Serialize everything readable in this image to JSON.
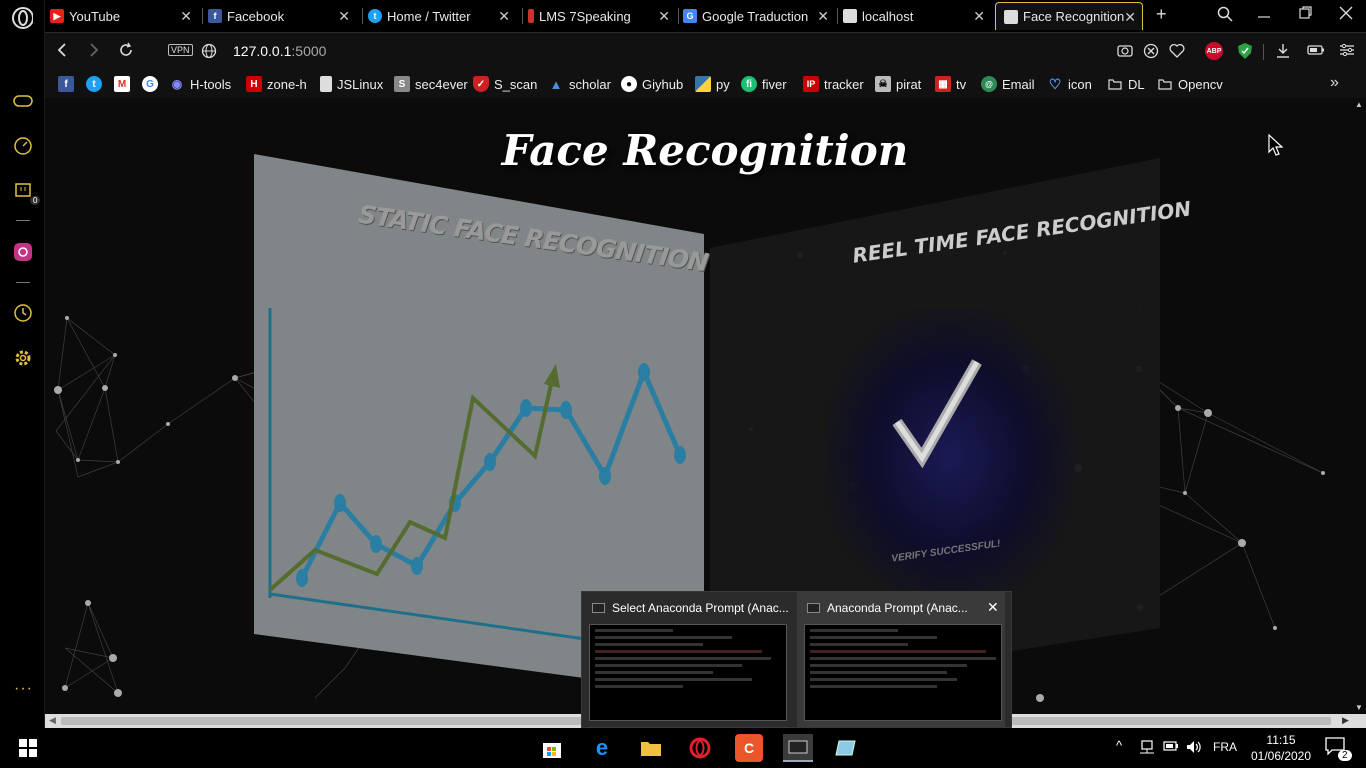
{
  "browser": {
    "tabs": [
      {
        "label": "YouTube",
        "icon": "youtube-icon",
        "color": "#e62117",
        "active": false
      },
      {
        "label": "Facebook",
        "icon": "facebook-icon",
        "color": "#3b5998",
        "active": false
      },
      {
        "label": "Home / Twitter",
        "icon": "twitter-icon",
        "color": "#1da1f2",
        "active": false
      },
      {
        "label": "LMS 7Speaking",
        "icon": "lms-icon",
        "color": "#d32f2f",
        "active": false
      },
      {
        "label": "Google Traduction",
        "icon": "google-translate-icon",
        "color": "#4285f4",
        "active": false
      },
      {
        "label": "localhost",
        "icon": "page-icon",
        "color": "#dddddd",
        "active": false
      },
      {
        "label": "Face Recognition",
        "icon": "page-icon",
        "color": "#dddddd",
        "active": true
      }
    ],
    "new_tab_label": "+",
    "address": {
      "vpn_label": "VPN",
      "host": "127.0.0.1",
      "port": ":5000"
    },
    "bookmarks": [
      {
        "label": "",
        "icon": "facebook-icon",
        "color": "#3b5998"
      },
      {
        "label": "",
        "icon": "twitter-icon",
        "color": "#1da1f2"
      },
      {
        "label": "",
        "icon": "gmail-icon",
        "color": "#d93025"
      },
      {
        "label": "",
        "icon": "google-icon",
        "color": "#ffffff"
      },
      {
        "label": "H-tools",
        "icon": "eye-icon",
        "color": "#8888ff"
      },
      {
        "label": "zone-h",
        "icon": "zone-h-icon",
        "color": "#cc0000"
      },
      {
        "label": "JSLinux",
        "icon": "page-icon",
        "color": "#dddddd"
      },
      {
        "label": "sec4ever",
        "icon": "sec4ever-icon",
        "color": "#888888"
      },
      {
        "label": "S_scan",
        "icon": "shield-icon",
        "color": "#cc2222"
      },
      {
        "label": "scholar",
        "icon": "scholar-icon",
        "color": "#4a90d9"
      },
      {
        "label": "Giyhub",
        "icon": "github-icon",
        "color": "#ffffff"
      },
      {
        "label": "py",
        "icon": "python-icon",
        "color": "#3776ab"
      },
      {
        "label": "fiver",
        "icon": "fiverr-icon",
        "color": "#1dbf73"
      },
      {
        "label": "tracker",
        "icon": "ip-icon",
        "color": "#cc0000"
      },
      {
        "label": "pirat",
        "icon": "pirate-icon",
        "color": "#bbbbbb"
      },
      {
        "label": "tv",
        "icon": "tv-icon",
        "color": "#cc2222"
      },
      {
        "label": "Email",
        "icon": "email-icon",
        "color": "#2e8b57"
      },
      {
        "label": "icon",
        "icon": "heart-icon",
        "color": "#4aa3ff"
      },
      {
        "label": "DL",
        "icon": "folder-icon",
        "color": "#dddddd"
      },
      {
        "label": "Opencv",
        "icon": "folder-icon",
        "color": "#dddddd"
      }
    ],
    "bookmarks_more": "»",
    "abp_label": "ABP"
  },
  "page": {
    "title": "Face Recognition",
    "left_panel_title": "STATIC FACE RECOGNITION",
    "right_panel_title": "REEL TIME FACE RECOGNITION",
    "verify_text": "VERIFY SUCCESSFUL!"
  },
  "thumbnails": [
    {
      "title": "Select Anaconda Prompt (Anac..."
    },
    {
      "title": "Anaconda Prompt (Anac..."
    }
  ],
  "sidebar": {
    "badge": "0"
  },
  "taskbar": {
    "language": "FRA",
    "time": "11:15",
    "date": "01/06/2020",
    "notification_count": "2"
  }
}
